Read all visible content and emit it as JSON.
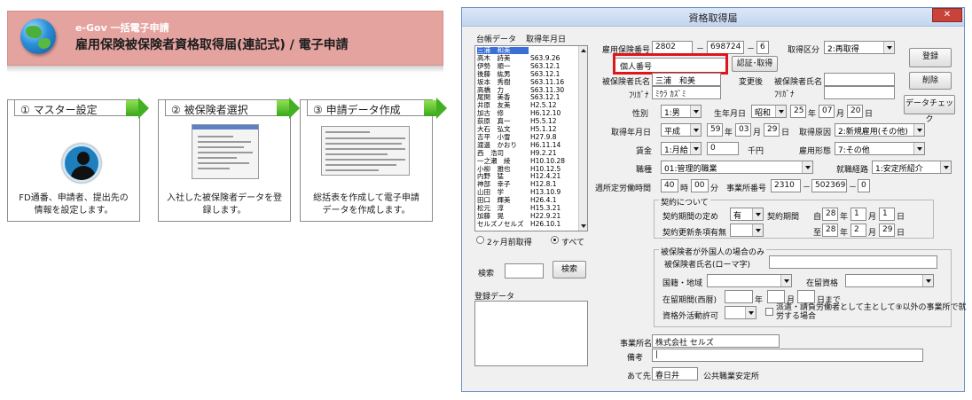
{
  "banner": {
    "subtitle": "e-Gov 一括電子申請",
    "title": "雇用保険被保険者資格取得届(連記式) / 電子申請"
  },
  "steps": [
    {
      "label": "① マスター設定",
      "desc1": "FD通番、申請者、提出先の",
      "desc2": "情報を設定します。"
    },
    {
      "label": "② 被保険者選択",
      "desc1": "入社した被保険者データを登",
      "desc2": "録します。"
    },
    {
      "label": "③ 申請データ作成",
      "desc1": "総括表を作成して電子申請",
      "desc2": "データを作成します。"
    }
  ],
  "dialog": {
    "title": "資格取得届",
    "close": "✕",
    "list_header_name": "台帳データ",
    "list_header_date": "取得年月日",
    "list_items": [
      {
        "name": "三浦　和美",
        "date": "S59.3.29"
      },
      {
        "name": "高木　詩美",
        "date": "S63.9.26"
      },
      {
        "name": "伊勢　順一",
        "date": "S63.12.1"
      },
      {
        "name": "後藤　紘男",
        "date": "S63.12.1"
      },
      {
        "name": "坂本　秀樹",
        "date": "S63.11.16"
      },
      {
        "name": "高橋　力",
        "date": "S63.11.30"
      },
      {
        "name": "尾関　美香",
        "date": "S63.12.1"
      },
      {
        "name": "井原　友美",
        "date": "H2.5.12"
      },
      {
        "name": "加古　修",
        "date": "H6.12.10"
      },
      {
        "name": "荻原　真一",
        "date": "H5.5.12"
      },
      {
        "name": "大石　弘文",
        "date": "H5.1.12"
      },
      {
        "name": "吉平　小雪",
        "date": "H27.9.8"
      },
      {
        "name": "渡邊　かおり",
        "date": "H6.11.14"
      },
      {
        "name": "西　浩司",
        "date": "H9.2.21"
      },
      {
        "name": "一之瀬　綾",
        "date": "H10.10.28"
      },
      {
        "name": "小柳　雅也",
        "date": "H10.12.5"
      },
      {
        "name": "内野　猛",
        "date": "H12.4.21"
      },
      {
        "name": "神部　幸子",
        "date": "H12.8.1"
      },
      {
        "name": "山田　学",
        "date": "H13.10.9"
      },
      {
        "name": "田口　輝美",
        "date": "H26.4.1"
      },
      {
        "name": "松元　淳",
        "date": "H15.3.21"
      },
      {
        "name": "加藤　晃",
        "date": "H22.9.21"
      },
      {
        "name": "セルズノセルズ",
        "date": "H26.10.1"
      }
    ],
    "radio_2months": "2ヶ月前取得",
    "radio_all": "すべて",
    "search_label": "検索",
    "search_button": "検索",
    "registered_label": "登録データ",
    "insurance_no_label": "雇用保険番号",
    "insurance_no_1": "2802",
    "insurance_no_2": "698724",
    "insurance_no_3": "6",
    "acq_type_label": "取得区分",
    "acq_type_value": "2:再取得",
    "register_button": "登録",
    "delete_button": "削除",
    "datacheck_button": "データチェック",
    "mynumber_label": "個人番号",
    "mynumber_value": "",
    "cert_button": "認証･取得",
    "name_label": "被保険者氏名",
    "name_value": "三浦　和美",
    "changed_label": "変更後",
    "changed_name_label": "被保険者氏名",
    "kana_label": "ﾌﾘｶﾞﾅ",
    "kana_value": "ﾐｳﾗ ｶｽﾞﾐ",
    "kana_label2": "ﾌﾘｶﾞﾅ",
    "gender_label": "性別",
    "gender_value": "1:男",
    "birth_label": "生年月日",
    "birth_era": "昭和",
    "birth_y": "25",
    "birth_m": "07",
    "birth_d": "20",
    "acq_date_label": "取得年月日",
    "acq_era": "平成",
    "acq_y": "59",
    "acq_m": "03",
    "acq_d": "29",
    "acq_cause_label": "取得原因",
    "acq_cause_value": "2:新規雇用(その他)",
    "wage_label": "賃金",
    "wage_type": "1:月給",
    "wage_value": "0",
    "wage_unit": "千円",
    "emp_form_label": "雇用形態",
    "emp_form_value": "7:その他",
    "job_label": "職種",
    "job_value": "01:管理的職業",
    "route_label": "就職経路",
    "route_value": "1:安定所紹介",
    "hours_label": "週所定労働時間",
    "hours_value": "40",
    "hours_unit": "時",
    "minutes_value": "00",
    "minutes_unit": "分",
    "office_no_label": "事業所番号",
    "office_no_1": "2310",
    "office_no_2": "502369",
    "office_no_3": "0",
    "year_u": "年",
    "month_u": "月",
    "day_u": "日",
    "dash": "－",
    "contract": {
      "title": "契約について",
      "period_label": "契約期間の定め",
      "period_value": "有",
      "period_label2": "契約期間",
      "from_label": "自",
      "from_y": "28",
      "from_m": "1",
      "from_d": "1",
      "renew_label": "契約更新条項有無",
      "to_label": "至",
      "to_y": "28",
      "to_m": "2",
      "to_d": "29"
    },
    "foreign": {
      "title": "被保険者が外国人の場合のみ",
      "roman_label": "被保険者氏名(ローマ字)",
      "nationality_label": "国籍・地域",
      "status_label": "在留資格",
      "period_label": "在留期間(西暦)",
      "until": "日まで",
      "permit_label": "資格外活動許可",
      "dispatch_line1": "派遣・請負労働者として主として⑨以外の事業所で就",
      "dispatch_line2": "労する場合"
    },
    "office_label": "事業所名",
    "office_value": "株式会社 セルズ",
    "note_label": "備考",
    "note_value": "|",
    "dest_label": "あて先",
    "dest_value": "春日井",
    "dest_suffix": "公共職業安定所"
  },
  "colors": {
    "banner": "#e5a3a0",
    "arrow": "#43b023",
    "highlight": "#e0141b",
    "selection": "#3b6fd6"
  }
}
